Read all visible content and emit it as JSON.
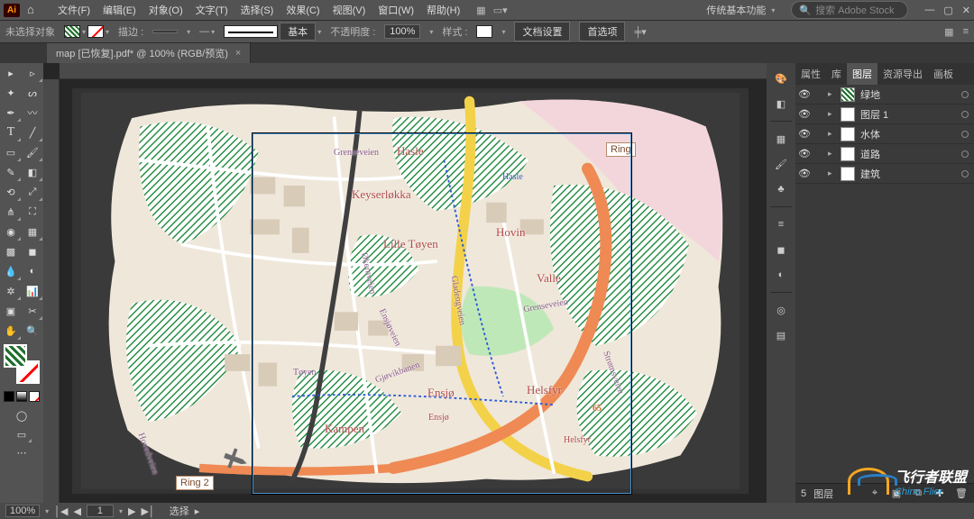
{
  "app_badge": "Ai",
  "menus": [
    "文件(F)",
    "编辑(E)",
    "对象(O)",
    "文字(T)",
    "选择(S)",
    "效果(C)",
    "视图(V)",
    "窗口(W)",
    "帮助(H)"
  ],
  "workspace": "传统基本功能",
  "search_placeholder": "搜索 Adobe Stock",
  "options": {
    "no_selection": "未选择对象",
    "stroke_label": "描边 :",
    "stroke_weight": "",
    "stroke_profile": "基本",
    "opacity_label": "不透明度 :",
    "opacity_value": "100%",
    "style_label": "样式 :",
    "doc_setup": "文档设置",
    "prefs": "首选项"
  },
  "document": {
    "title": "map [已恢复].pdf* @ 100% (RGB/预览)"
  },
  "map_labels": {
    "hasle": "Hasle",
    "hasle2": "Hasle",
    "grenseveien": "Grenseveien",
    "keyser": "Keyserløkka",
    "lille": "Lille Tøyen",
    "hovin": "Hovin",
    "valle": "Valle",
    "ensjo": "Ensjø",
    "ensjo2": "Ensjø",
    "helsfyr": "Helsfyr",
    "helsfyr2": "Helsfyr",
    "kampen": "Kampen",
    "toyen": "Tøyen",
    "gladengveien": "Gladengveien",
    "ensjoveien": "Ensjøveien",
    "gjobanen": "Gjøvikbanen",
    "okernveien": "Økernveien",
    "stromsveien": "Strømsveien",
    "grenseveien2": "Grenseveien",
    "hovedveien": "Hovedveien",
    "num65": "65",
    "ring": "Ring",
    "ring2": "Ring 2"
  },
  "panel_tabs": [
    "属性",
    "库",
    "图层",
    "资源导出",
    "画板"
  ],
  "layers": [
    {
      "name": "绿地",
      "pat": true
    },
    {
      "name": "图层 1",
      "pat": false
    },
    {
      "name": "水体",
      "pat": false
    },
    {
      "name": "道路",
      "pat": false
    },
    {
      "name": "建筑",
      "pat": false
    }
  ],
  "panel_footer": {
    "count": "5",
    "label": "图层"
  },
  "status": {
    "zoom": "100%",
    "artboard": "1",
    "tool": "选择"
  },
  "watermark": {
    "line1": "飞行者联盟",
    "line2": "China Flier"
  }
}
